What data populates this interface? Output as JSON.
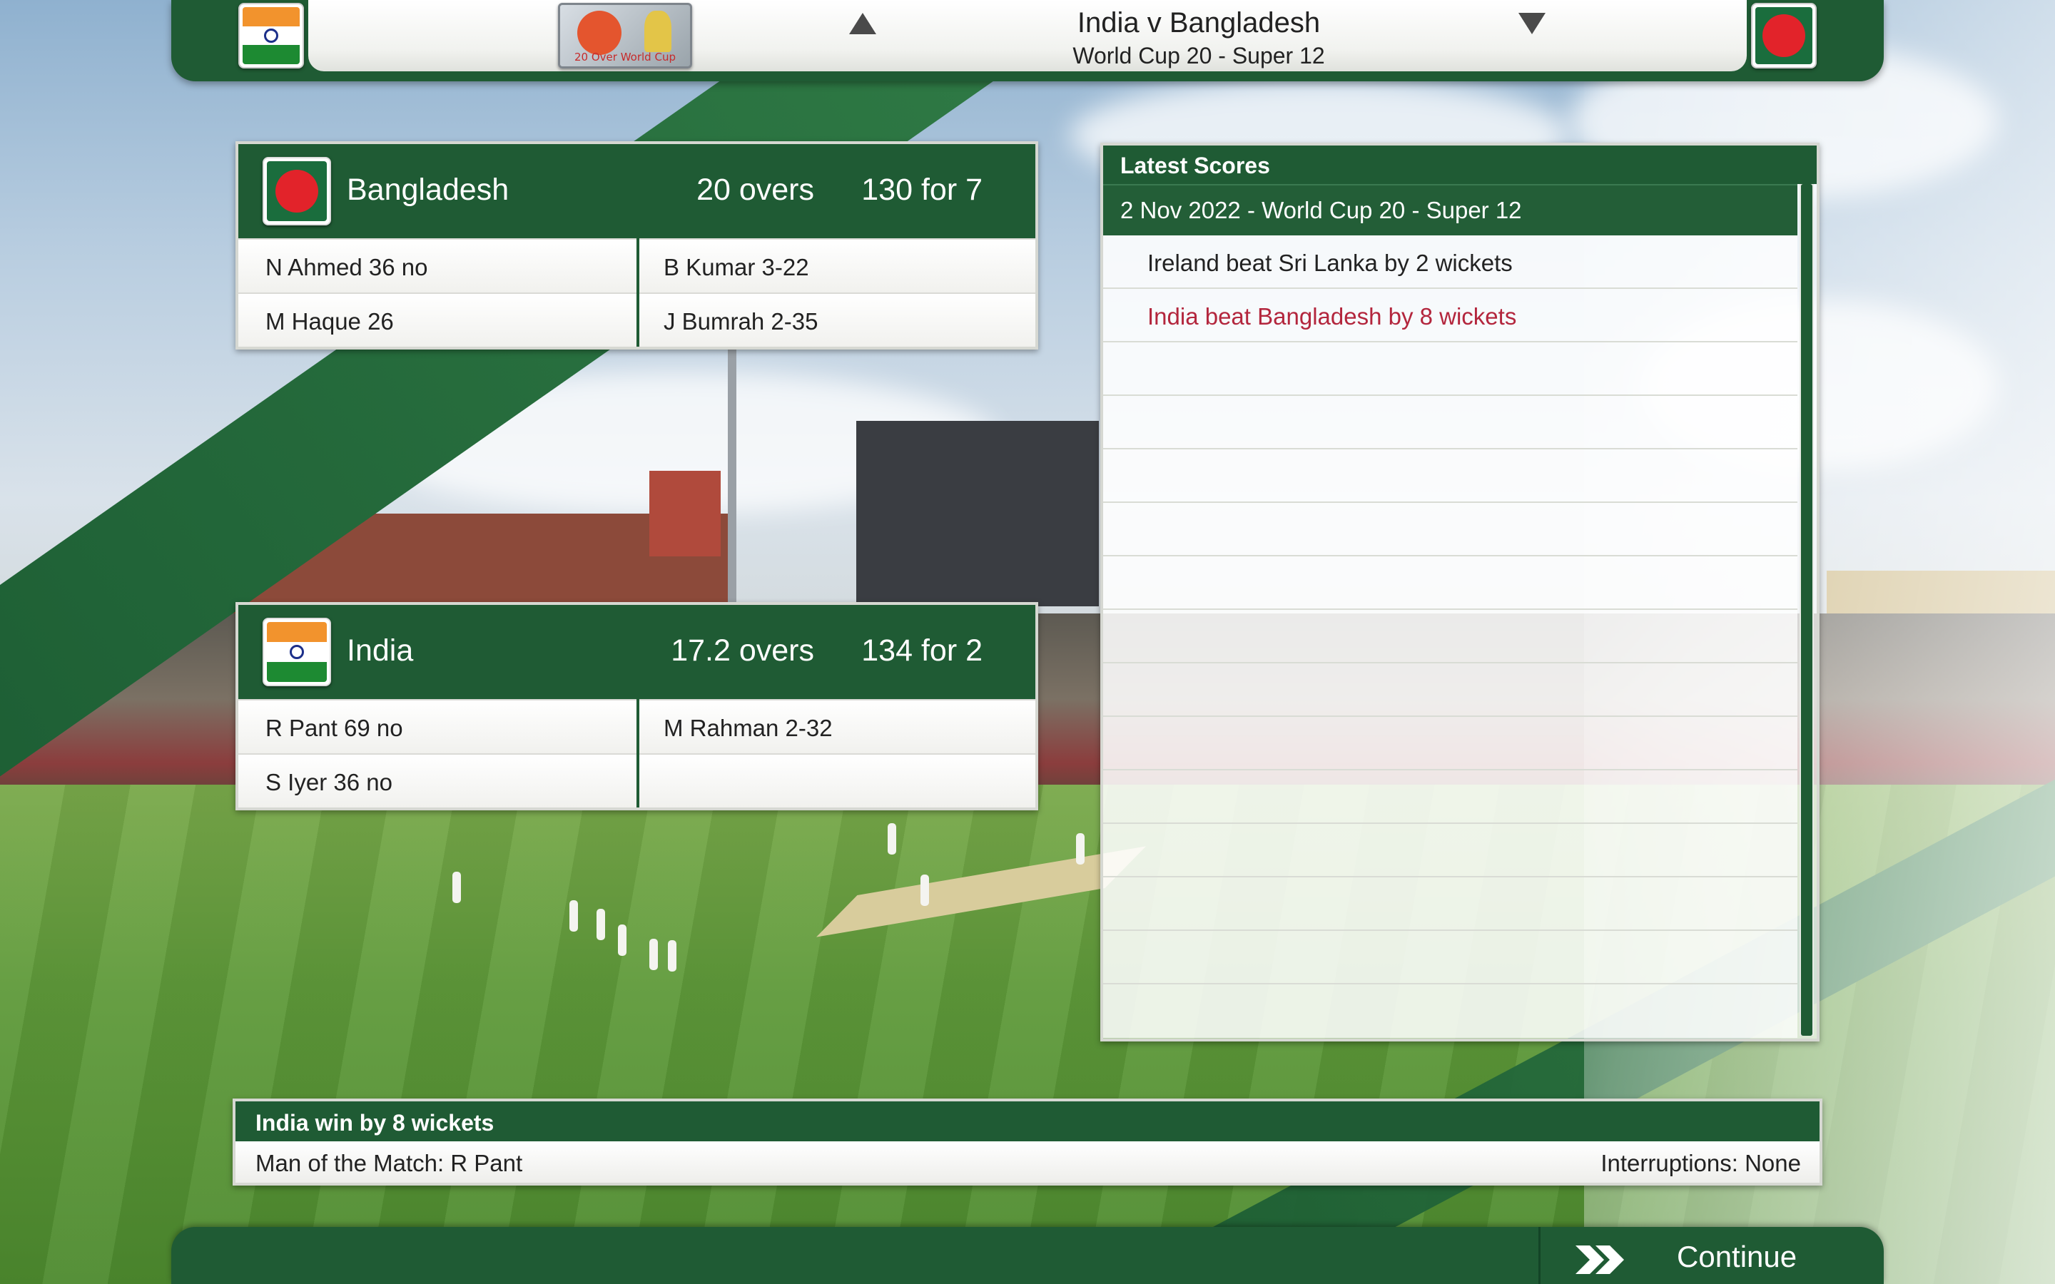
{
  "header": {
    "match_title": "India v Bangladesh",
    "match_subtitle": "World Cup 20 - Super 12",
    "competition_logo_text": "20 Over World Cup",
    "home_flag": "india-flag-icon",
    "away_flag": "bangladesh-flag-icon"
  },
  "innings": [
    {
      "team": "Bangladesh",
      "overs": "20 overs",
      "score": "130 for 7",
      "rows": [
        {
          "batter": "N Ahmed 36 no",
          "bowler": "B Kumar 3-22"
        },
        {
          "batter": "M Haque 26",
          "bowler": "J Bumrah 2-35"
        }
      ]
    },
    {
      "team": "India",
      "overs": "17.2 overs",
      "score": "134 for 2",
      "rows": [
        {
          "batter": "R Pant 69 no",
          "bowler": "M Rahman 2-32"
        },
        {
          "batter": "S Iyer 36 no",
          "bowler": ""
        }
      ]
    }
  ],
  "latest_scores": {
    "title": "Latest Scores",
    "date_heading": "2 Nov 2022 - World Cup 20 - Super 12",
    "results": [
      "Ireland beat Sri Lanka by 2 wickets",
      "India beat Bangladesh by 8 wickets"
    ],
    "highlight_index": 1
  },
  "result": {
    "headline": "India win by 8 wickets",
    "man_of_match": "Man of the Match: R Pant",
    "interruptions": "Interruptions: None"
  },
  "footer": {
    "continue_label": "Continue",
    "continue_icon": "double-chevron-right-icon"
  },
  "colors": {
    "primary_green": "#1f5b34",
    "highlight_red": "#b3263d",
    "india_saffron": "#f2932d",
    "india_green": "#1d8a32",
    "bangladesh_green": "#1a6d3d",
    "bangladesh_red": "#e2232a"
  }
}
